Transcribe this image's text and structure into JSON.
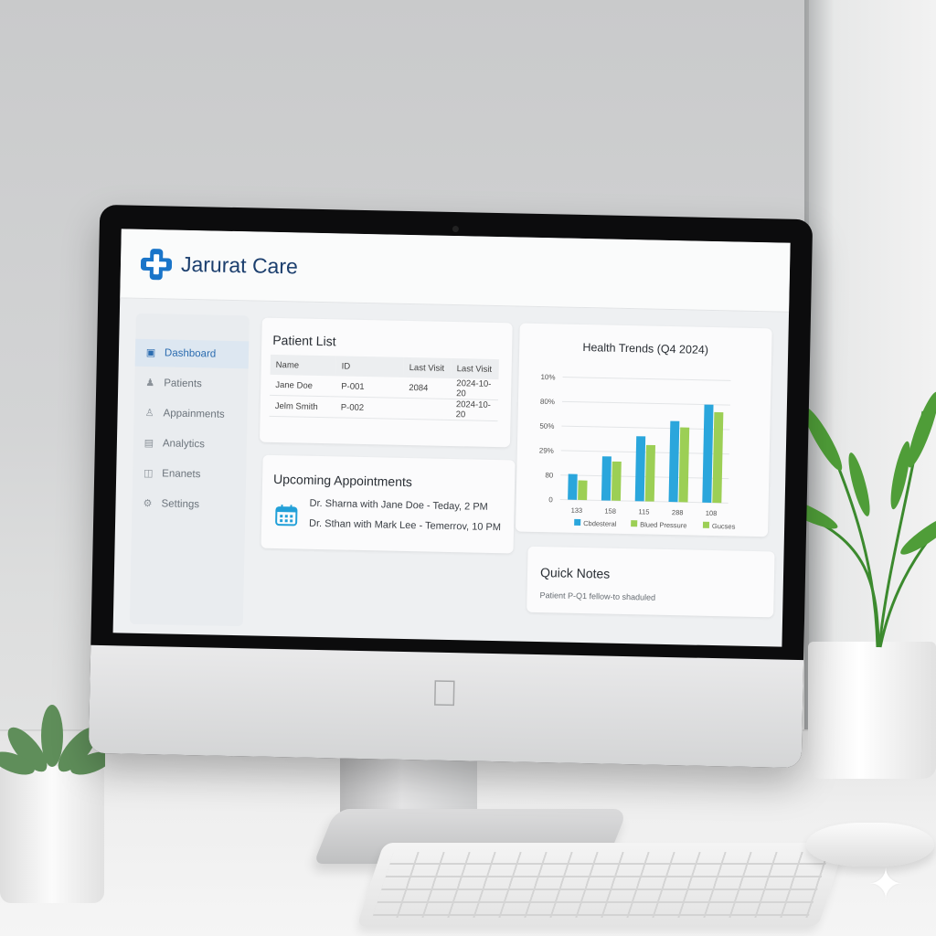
{
  "app": {
    "title": "Jarurat Care",
    "brand_color": "#1a75c9"
  },
  "sidebar": {
    "items": [
      {
        "label": "Dashboard",
        "icon": "dashboard-icon",
        "active": true
      },
      {
        "label": "Patients",
        "icon": "patients-icon",
        "active": false
      },
      {
        "label": "Appainments",
        "icon": "appointments-icon",
        "active": false
      },
      {
        "label": "Analytics",
        "icon": "analytics-icon",
        "active": false
      },
      {
        "label": "Enanets",
        "icon": "database-icon",
        "active": false
      },
      {
        "label": "Settings",
        "icon": "settings-icon",
        "active": false
      }
    ]
  },
  "patient_list": {
    "title": "Patient List",
    "columns": [
      "Name",
      "ID",
      "Last Visit",
      "Last Visit"
    ],
    "rows": [
      [
        "Jane Doe",
        "P-001",
        "2084",
        "2024-10-20"
      ],
      [
        "Jelm Smith",
        "P-002",
        "",
        "2024-10-20"
      ]
    ]
  },
  "appointments": {
    "title": "Upcoming Appointments",
    "icon": "calendar-icon",
    "items": [
      "Dr. Sharna with Jane Doe - Teday, 2 PM",
      "Dr. Sthan with Mark Lee - Temerrov, 10 PM"
    ]
  },
  "quick_notes": {
    "title": "Quick Notes",
    "text": "Patient P-Q1 fellow-to shaduled"
  },
  "chart_data": {
    "type": "bar",
    "title": "Health Trends (Q4 2024)",
    "categories": [
      "133",
      "158",
      "115",
      "288",
      "108"
    ],
    "y_ticks": [
      "0",
      "80",
      "29%",
      "50%",
      "80%",
      "10%"
    ],
    "ylim": [
      0,
      5
    ],
    "grid": true,
    "legend_position": "bottom",
    "series": [
      {
        "name": "Cbdesteral",
        "color": "#2aa6dc",
        "values": [
          1.05,
          1.8,
          2.65,
          3.3,
          4.0
        ]
      },
      {
        "name": "Blued Pressure",
        "color": "#9ccf55",
        "values": [
          0.8,
          1.6,
          2.3,
          3.05,
          3.7
        ]
      }
    ],
    "extra_legend": {
      "name": "Gucses",
      "color": "#9ccf55"
    }
  }
}
